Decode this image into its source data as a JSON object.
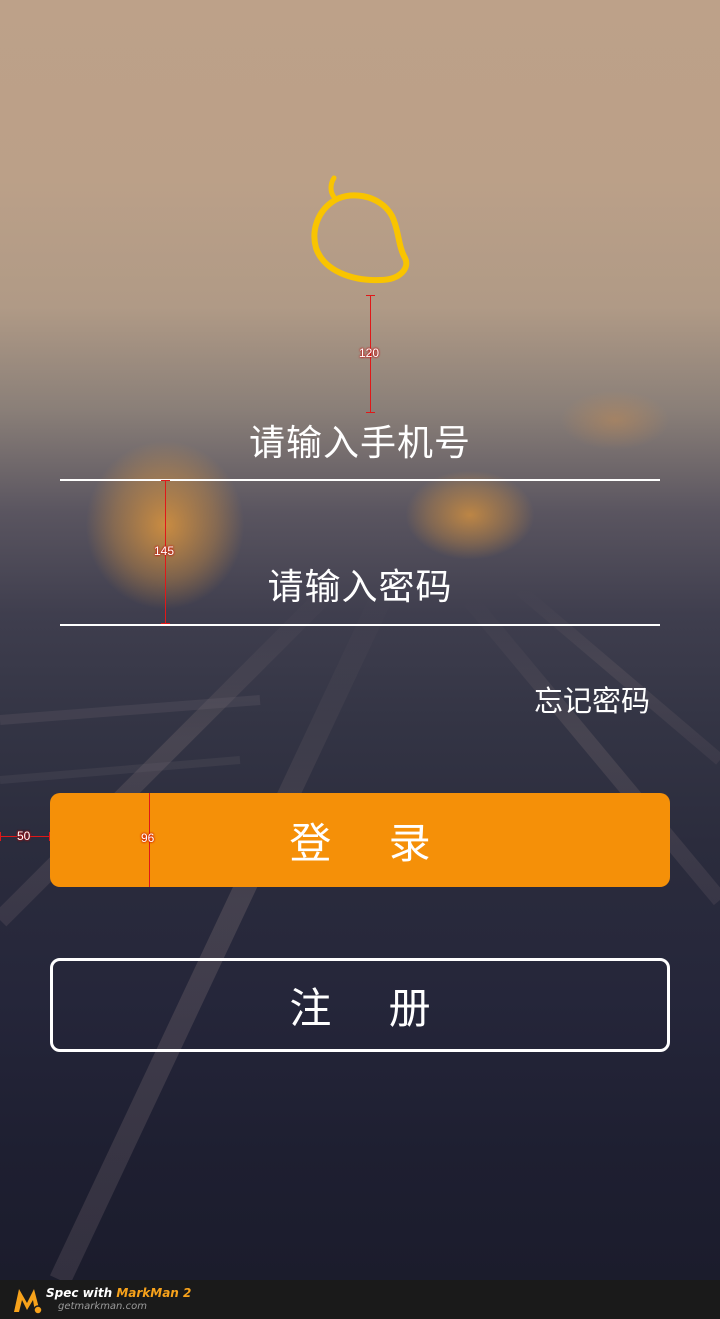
{
  "login": {
    "phone_placeholder": "请输入手机号",
    "password_placeholder": "请输入密码",
    "forgot_password": "忘记密码",
    "login_button": "登 录",
    "register_button": "注 册"
  },
  "logo": {
    "icon": "mango-icon",
    "color": "#f9c400"
  },
  "measurements": {
    "logo_to_phone": "120",
    "field_height": "145",
    "left_margin": "50",
    "button_height": "96"
  },
  "colors": {
    "accent": "#f59008",
    "text": "#ffffff"
  },
  "footer": {
    "prefix": "Spec with ",
    "brand": "MarkMan 2",
    "url": "getmarkman.com"
  }
}
